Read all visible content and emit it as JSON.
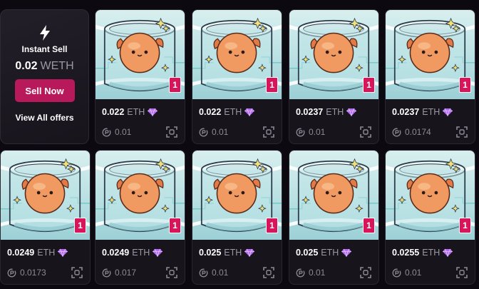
{
  "instant_sell": {
    "title": "Instant Sell",
    "price": "0.02",
    "currency": "WETH",
    "button_label": "Sell Now",
    "view_all_label": "View All offers",
    "icon": "lightning-icon"
  },
  "colors": {
    "background": "#0c0a10",
    "card": "#17141c",
    "accent": "#b8195a",
    "badge": "#d8145a",
    "gem": "#b46cf0"
  },
  "cards": [
    {
      "price": "0.022",
      "currency": "ETH",
      "last_offer": "0.01",
      "quantity": "1"
    },
    {
      "price": "0.022",
      "currency": "ETH",
      "last_offer": "0.01",
      "quantity": "1"
    },
    {
      "price": "0.0237",
      "currency": "ETH",
      "last_offer": "0.01",
      "quantity": "1"
    },
    {
      "price": "0.0237",
      "currency": "ETH",
      "last_offer": "0.0174",
      "quantity": "1"
    },
    {
      "price": "0.0249",
      "currency": "ETH",
      "last_offer": "0.0173",
      "quantity": "1"
    },
    {
      "price": "0.0249",
      "currency": "ETH",
      "last_offer": "0.017",
      "quantity": "1"
    },
    {
      "price": "0.025",
      "currency": "ETH",
      "last_offer": "0.01",
      "quantity": "1"
    },
    {
      "price": "0.025",
      "currency": "ETH",
      "last_offer": "0.01",
      "quantity": "1"
    },
    {
      "price": "0.0255",
      "currency": "ETH",
      "last_offer": "0.01",
      "quantity": "1"
    }
  ]
}
